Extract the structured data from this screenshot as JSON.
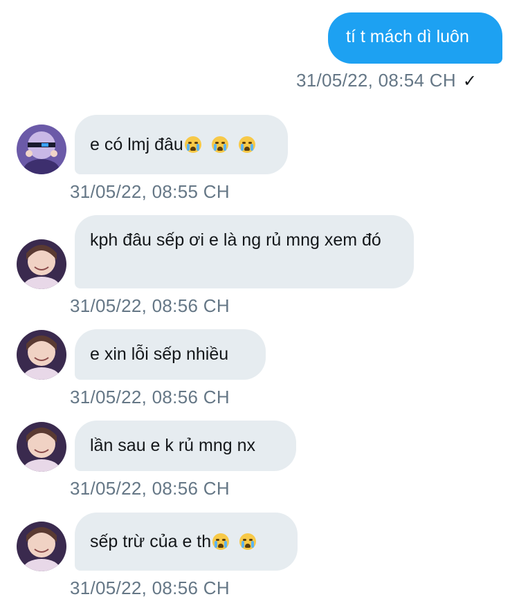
{
  "conversation": {
    "outgoing": {
      "text": "tí t mách dì luôn",
      "timestamp": "31/05/22, 08:54 CH",
      "status_icon": "checkmark-icon",
      "status_glyph": "✓"
    },
    "incoming": [
      {
        "text": "e có lmj đâu",
        "emoji_count": 3,
        "timestamp": "31/05/22, 08:55 CH",
        "emoji": "loudly-crying-face"
      },
      {
        "text": "kph đâu sếp ơi e là ng rủ mng xem đó",
        "emoji_count": 0,
        "timestamp": "31/05/22, 08:56 CH"
      },
      {
        "text": "e xin lỗi sếp nhiều",
        "emoji_count": 0,
        "timestamp": "31/05/22, 08:56 CH"
      },
      {
        "text": "lần sau e k rủ mng nx",
        "emoji_count": 0,
        "timestamp": "31/05/22, 08:56 CH"
      },
      {
        "text": "sếp trừ của e th",
        "emoji_count": 2,
        "timestamp": "31/05/22, 08:56 CH",
        "emoji": "loudly-crying-face"
      }
    ]
  },
  "colors": {
    "outgoing_bubble": "#1da1f2",
    "incoming_bubble": "#e6ecf0",
    "timestamp": "#657786"
  }
}
